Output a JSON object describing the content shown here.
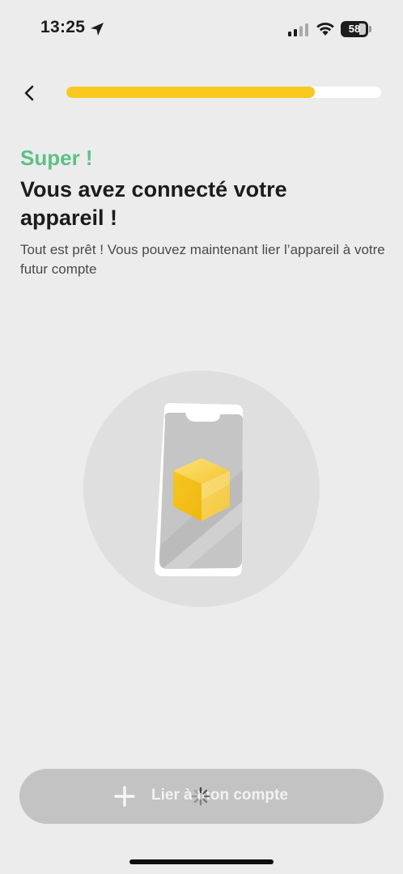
{
  "status_bar": {
    "time": "13:25",
    "battery": "58",
    "icons": [
      "location-arrow-icon",
      "cellular-signal-icon",
      "wifi-icon",
      "battery-icon"
    ]
  },
  "header": {
    "back_icon": "chevron-left-icon",
    "progress": 0.79,
    "progress_color": "#f8c81f"
  },
  "content": {
    "eyebrow": "Super !",
    "eyebrow_color": "#5cc185",
    "title": "Vous avez connecté votre appareil !",
    "subtitle": "Tout est prêt ! Vous pouvez maintenant lier l’appareil à votre futur compte"
  },
  "illustration": {
    "icon": "phone-with-cube-icon",
    "cube_color": "#f5c52a"
  },
  "action": {
    "label": "Lier à mon compte",
    "icon": "plus-icon",
    "loading_icon": "spinner-icon",
    "state": "loading"
  }
}
